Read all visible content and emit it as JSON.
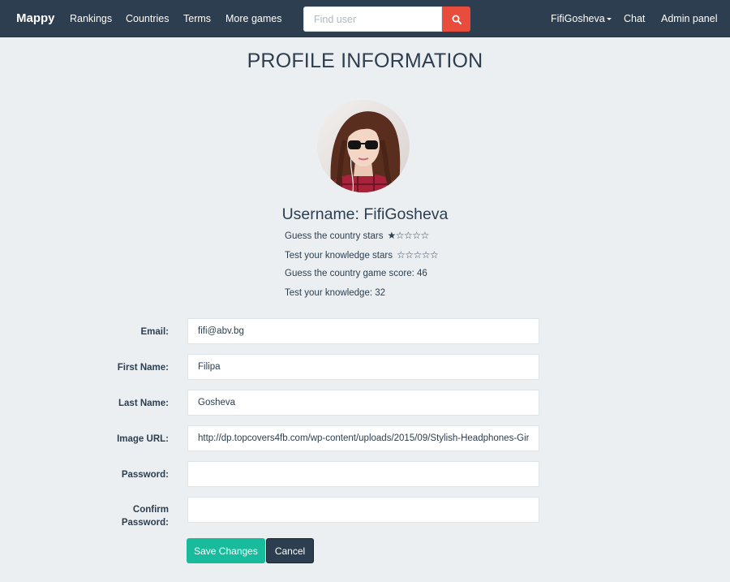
{
  "nav": {
    "brand": "Mappy",
    "links": [
      "Rankings",
      "Countries",
      "Terms",
      "More games"
    ],
    "search_placeholder": "Find user",
    "user": "FifiGosheva",
    "chat": "Chat",
    "admin": "Admin panel"
  },
  "page": {
    "title": "PROFILE INFORMATION"
  },
  "profile": {
    "username": "Username: FifiGosheva",
    "stats": [
      {
        "label": "Guess the country stars",
        "rating": 1,
        "max": 5
      },
      {
        "label": "Test your knowledge stars",
        "rating": 0,
        "max": 5
      },
      {
        "label": "Guess the country game score: 46"
      },
      {
        "label": "Test your knowledge: 32"
      }
    ]
  },
  "form": {
    "email_label": "Email:",
    "email": "fifi@abv.bg",
    "first_name_label": "First Name:",
    "first_name": "Filipa",
    "last_name_label": "Last Name:",
    "last_name": "Gosheva",
    "image_url_label": "Image URL:",
    "image_url": "http://dp.topcovers4fb.com/wp-content/uploads/2015/09/Stylish-Headphones-Girl-Display-Picture.jpg",
    "password_label": "Password:",
    "password": "",
    "confirm_label_1": "Confirm",
    "confirm_label_2": "Password:",
    "confirm_password": ""
  },
  "buttons": {
    "save": "Save Changes",
    "cancel": "Cancel"
  },
  "colors": {
    "navbar": "#2c3e50",
    "search_button": "#e74c3c",
    "save_button": "#18bc9c",
    "cancel_button": "#2c3e50",
    "background": "#eceff1"
  },
  "icons": {
    "search": "search-icon",
    "dropdown": "caret-down-icon",
    "star_filled": "star-filled-icon",
    "star_empty": "star-empty-icon"
  }
}
